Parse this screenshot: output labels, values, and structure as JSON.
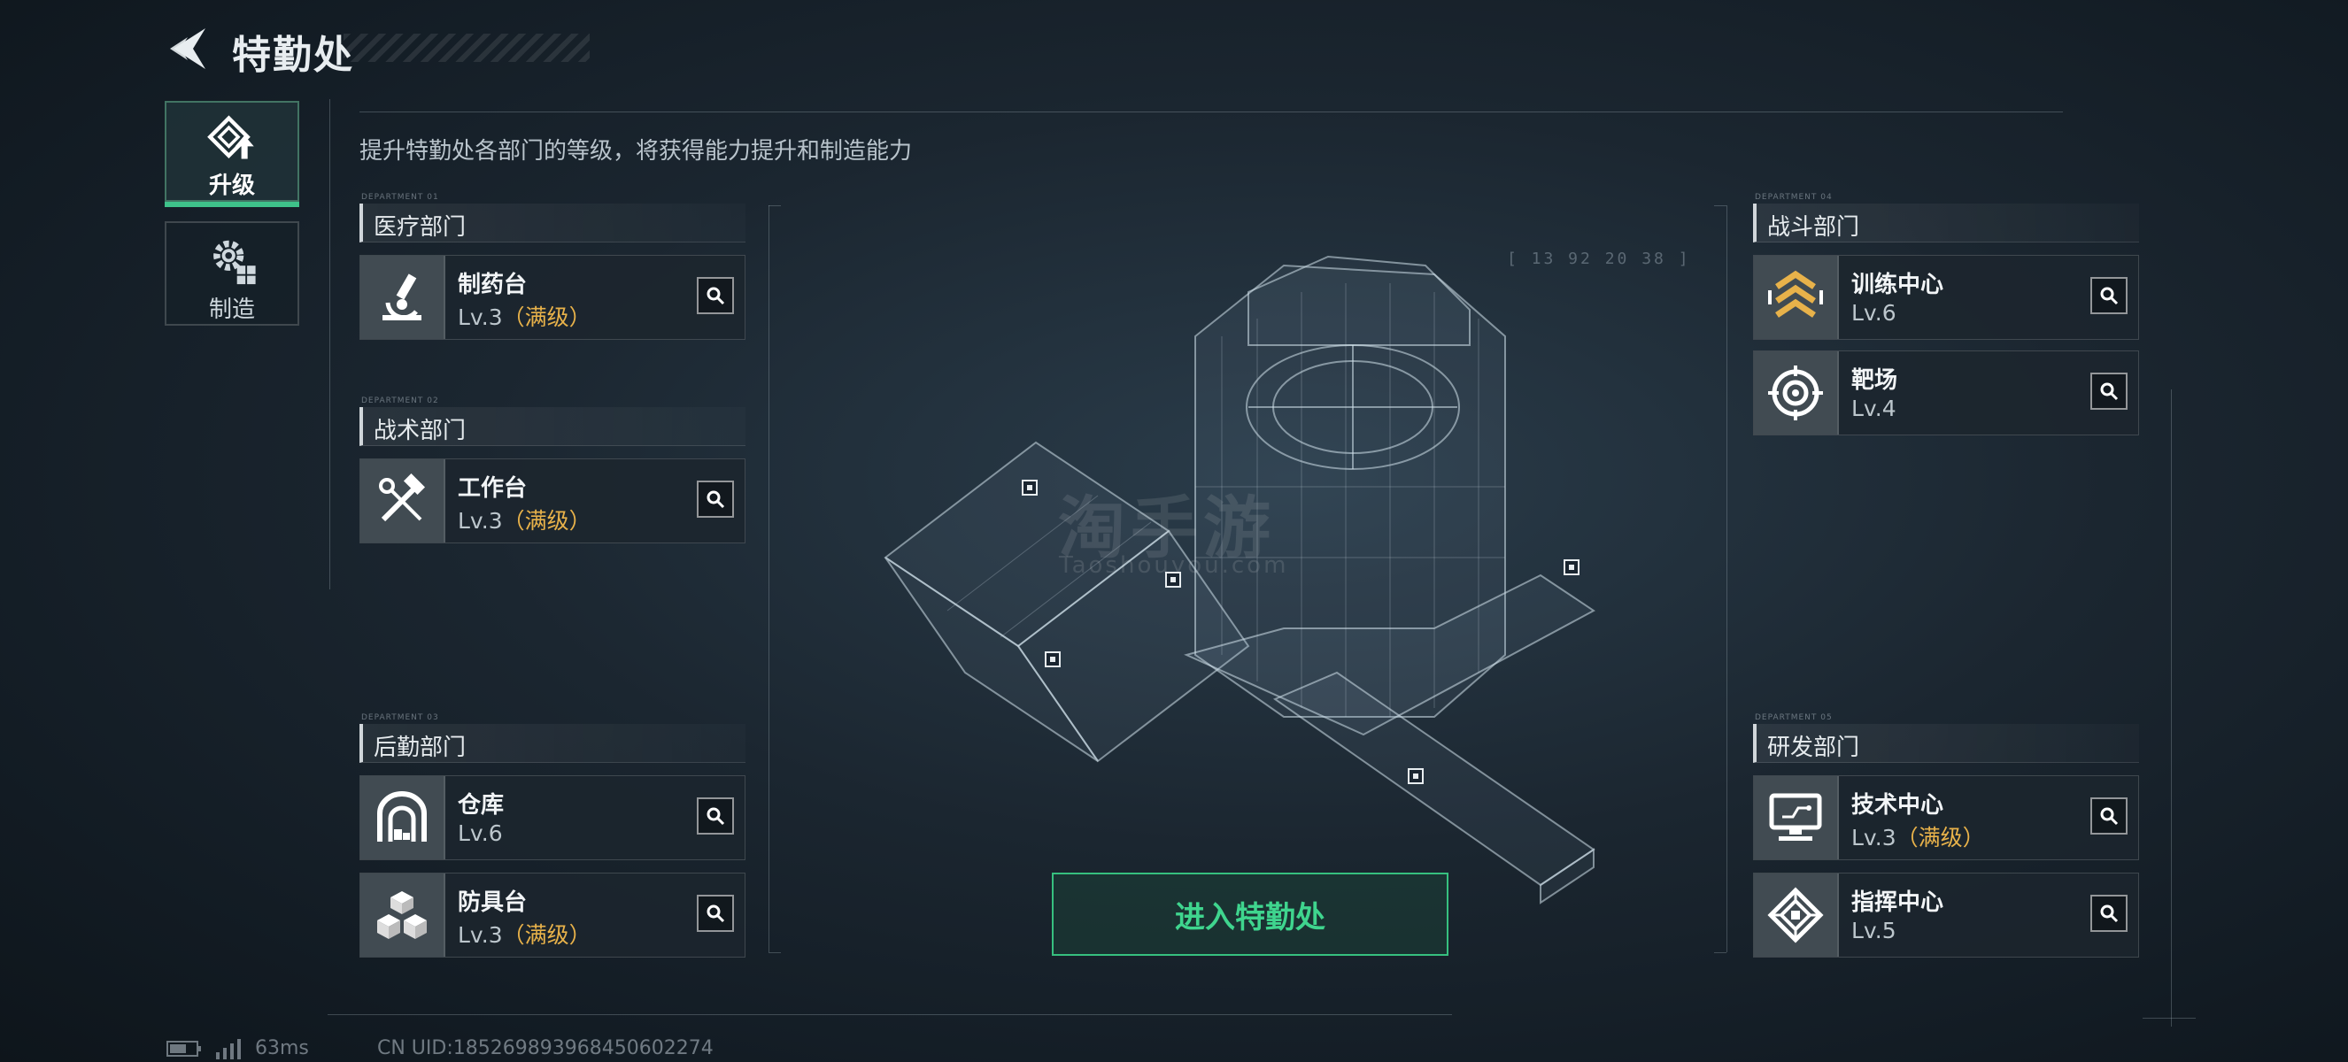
{
  "header": {
    "title": "特勤处"
  },
  "side_tabs": [
    {
      "label": "升级",
      "icon": "upgrade-icon",
      "active": true
    },
    {
      "label": "制造",
      "icon": "craft-gear-icon",
      "active": false
    }
  ],
  "subtitle": "提升特勤处各部门的等级，将获得能力提升和制造能力",
  "departments": {
    "medical": {
      "tag": "DEPARTMENT 01",
      "title": "医疗部门",
      "items": [
        {
          "name": "制药台",
          "level": "Lv.3",
          "max": "（满级）",
          "icon": "microscope-icon"
        }
      ]
    },
    "tactical": {
      "tag": "DEPARTMENT 02",
      "title": "战术部门",
      "items": [
        {
          "name": "工作台",
          "level": "Lv.3",
          "max": "（满级）",
          "icon": "tools-icon"
        }
      ]
    },
    "logistics": {
      "tag": "DEPARTMENT 03",
      "title": "后勤部门",
      "items": [
        {
          "name": "仓库",
          "level": "Lv.6",
          "max": "",
          "icon": "warehouse-icon"
        },
        {
          "name": "防具台",
          "level": "Lv.3",
          "max": "（满级）",
          "icon": "armor-cubes-icon"
        }
      ]
    },
    "combat": {
      "tag": "DEPARTMENT 04",
      "title": "战斗部门",
      "items": [
        {
          "name": "训练中心",
          "level": "Lv.6",
          "max": "",
          "icon": "chevrons-icon"
        },
        {
          "name": "靶场",
          "level": "Lv.4",
          "max": "",
          "icon": "target-icon"
        }
      ]
    },
    "research": {
      "tag": "DEPARTMENT 05",
      "title": "研发部门",
      "items": [
        {
          "name": "技术中心",
          "level": "Lv.3",
          "max": "（满级）",
          "icon": "monitor-icon"
        },
        {
          "name": "指挥中心",
          "level": "Lv.5",
          "max": "",
          "icon": "command-chip-icon"
        }
      ]
    }
  },
  "center": {
    "enter_button": "进入特勤处",
    "hud_readout": "[ 13 92    20 38 ]",
    "watermark": "淘手游",
    "watermark_sub": "Taoshouyou.com"
  },
  "status_bar": {
    "ping": "63ms",
    "uid": "CN UID:1852698939684506022​74"
  },
  "colors": {
    "accent_green": "#3ec28a",
    "max_level": "#e8b24a",
    "background": "#1b2630"
  }
}
